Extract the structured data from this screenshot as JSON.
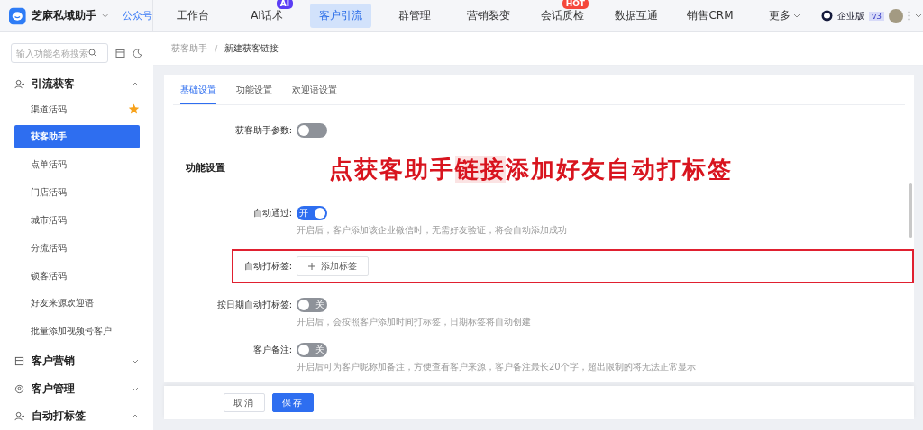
{
  "app": {
    "name": "芝麻私域助手",
    "account": "公众号"
  },
  "nav": [
    {
      "label": "工作台",
      "selected": false
    },
    {
      "label": "AI话术",
      "selected": false,
      "badge": "AI",
      "color": "#5b3df5"
    },
    {
      "label": "客户引流",
      "selected": true
    },
    {
      "label": "群管理",
      "selected": false
    },
    {
      "label": "营销裂变",
      "selected": false
    },
    {
      "label": "会话质检",
      "selected": false,
      "badge": "HOT",
      "color": "#f5483b"
    },
    {
      "label": "数据互通",
      "selected": false
    },
    {
      "label": "销售CRM",
      "selected": false
    },
    {
      "label": "更多",
      "selected": false,
      "caret": true
    }
  ],
  "account": {
    "edition": "企业版",
    "version": "v3"
  },
  "sidebar": {
    "search": {
      "placeholder": "输入功能名称搜索"
    },
    "groups": [
      {
        "label": "引流获客",
        "expanded": true,
        "children": [
          {
            "label": "渠道活码",
            "selected": false,
            "starred": true
          },
          {
            "label": "获客助手",
            "selected": true,
            "starred": false
          },
          {
            "label": "点单活码",
            "selected": false,
            "starred": false
          },
          {
            "label": "门店活码",
            "selected": false,
            "starred": false
          },
          {
            "label": "城市活码",
            "selected": false,
            "starred": false
          },
          {
            "label": "分流活码",
            "selected": false,
            "starred": false
          },
          {
            "label": "锁客活码",
            "selected": false,
            "starred": false
          },
          {
            "label": "好友来源欢迎语",
            "selected": false,
            "starred": false
          },
          {
            "label": "批量添加视频号客户",
            "selected": false,
            "starred": false
          }
        ]
      },
      {
        "label": "客户营销",
        "expanded": false
      },
      {
        "label": "客户管理",
        "expanded": false
      },
      {
        "label": "自动打标签",
        "expanded": true
      }
    ]
  },
  "breadcrumb": [
    "获客助手",
    "新建获客链接"
  ],
  "breadcrumb_separator": "/",
  "tabs": [
    {
      "label": "基础设置",
      "selected": true
    },
    {
      "label": "功能设置",
      "selected": false
    },
    {
      "label": "欢迎语设置",
      "selected": false
    }
  ],
  "rows": [
    {
      "kind": "toggle",
      "label": "获客助手参数:",
      "on": false
    },
    {
      "kind": "section",
      "label": "功能设置"
    },
    {
      "kind": "toggle",
      "label": "自动通过:",
      "on": true,
      "toggle_text": "开",
      "hint": "开启后，客户添加该企业微信时，无需好友验证，将会自动添加成功"
    },
    {
      "kind": "tags",
      "label": "自动打标签:",
      "button": "添加标签",
      "highlighted": true
    },
    {
      "kind": "toggle",
      "label": "按日期自动打标签:",
      "on": false,
      "toggle_text": "关",
      "hint": "开启后，会按照客户添加时间打标签，日期标签将自动创建"
    },
    {
      "kind": "toggle",
      "label": "客户备注:",
      "on": false,
      "toggle_text": "关",
      "hint": "开启后可为客户昵称加备注，方便查看客户来源，客户备注最长20个字，超出限制的将无法正常显示"
    }
  ],
  "annotation": [
    {
      "text": "点获客助手",
      "highlighted": false
    },
    {
      "text": "链接",
      "highlighted": true
    },
    {
      "text": "添加好友自动打标签",
      "highlighted": false
    }
  ],
  "footer": {
    "buttons": [
      {
        "label": "取消",
        "kind": "default"
      },
      {
        "label": "保存",
        "kind": "primary"
      }
    ]
  }
}
